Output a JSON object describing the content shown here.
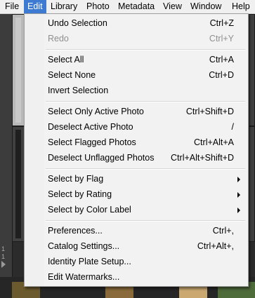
{
  "menubar": {
    "items": [
      "File",
      "Edit",
      "Library",
      "Photo",
      "Metadata",
      "View",
      "Window",
      "Help"
    ],
    "active": "Edit"
  },
  "background": {
    "row_numbers": [
      "1",
      "1"
    ]
  },
  "edit_menu": {
    "groups": [
      [
        {
          "label": "Undo Selection",
          "shortcut": "Ctrl+Z",
          "enabled": true
        },
        {
          "label": "Redo",
          "shortcut": "Ctrl+Y",
          "enabled": false
        }
      ],
      [
        {
          "label": "Select All",
          "shortcut": "Ctrl+A",
          "enabled": true
        },
        {
          "label": "Select None",
          "shortcut": "Ctrl+D",
          "enabled": true
        },
        {
          "label": "Invert Selection",
          "shortcut": "",
          "enabled": true
        }
      ],
      [
        {
          "label": "Select Only Active Photo",
          "shortcut": "Ctrl+Shift+D",
          "enabled": true
        },
        {
          "label": "Deselect Active Photo",
          "shortcut": "/",
          "enabled": true
        },
        {
          "label": "Select Flagged Photos",
          "shortcut": "Ctrl+Alt+A",
          "enabled": true
        },
        {
          "label": "Deselect Unflagged Photos",
          "shortcut": "Ctrl+Alt+Shift+D",
          "enabled": true
        }
      ],
      [
        {
          "label": "Select by Flag",
          "shortcut": "",
          "enabled": true,
          "submenu": true
        },
        {
          "label": "Select by Rating",
          "shortcut": "",
          "enabled": true,
          "submenu": true
        },
        {
          "label": "Select by Color Label",
          "shortcut": "",
          "enabled": true,
          "submenu": true
        }
      ],
      [
        {
          "label": "Preferences...",
          "shortcut": "Ctrl+,",
          "enabled": true
        },
        {
          "label": "Catalog Settings...",
          "shortcut": "Ctrl+Alt+,",
          "enabled": true
        },
        {
          "label": "Identity Plate Setup...",
          "shortcut": "",
          "enabled": true
        },
        {
          "label": "Edit Watermarks...",
          "shortcut": "",
          "enabled": true
        }
      ]
    ]
  },
  "colors": {
    "menu_highlight": "#3d7bd2",
    "menu_bg": "#f2f2f2",
    "disabled_text": "#8f8f8f",
    "app_bg": "#2b2b2b"
  }
}
